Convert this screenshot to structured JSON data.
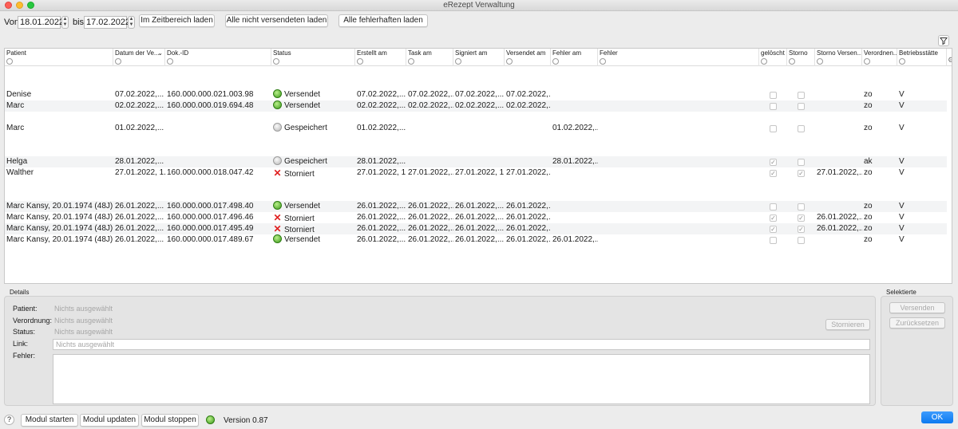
{
  "window": {
    "title": "eRezept Verwaltung"
  },
  "toolbar": {
    "from_label": "Von",
    "from_date": "18.01.2022",
    "to_label": "bis",
    "to_date": "17.02.2022",
    "btn_range": "Im Zeitbereich laden",
    "btn_unsent": "Alle nicht versendeten laden",
    "btn_errors": "Alle fehlerhaften laden"
  },
  "table": {
    "columns": [
      "Patient",
      "Datum der Ve...",
      "Dok.-ID",
      "Status",
      "Erstellt am",
      "Task am",
      "Signiert am",
      "Versendet am",
      "Fehler am",
      "Fehler",
      "gelöscht",
      "Storno",
      "Storno Versen...",
      "Verordnen...",
      "Betriebsstätte"
    ],
    "sort_indicator": "⌄",
    "rows": [
      {
        "patient": "Denise",
        "datum": "07.02.2022,...",
        "dok": "160.000.000.021.003.98",
        "status": "Versendet",
        "status_icon": "green",
        "erstellt": "07.02.2022,...",
        "task": "07.02.2022,...",
        "signiert": "07.02.2022,...",
        "versendet": "07.02.2022,...",
        "fehler_am": "",
        "fehler": "",
        "geloescht": false,
        "storno": false,
        "storno_versendet": "",
        "verordner": "zo",
        "betrieb": "V"
      },
      {
        "patient": "Marc",
        "datum": "02.02.2022,...",
        "dok": "160.000.000.019.694.48",
        "status": "Versendet",
        "status_icon": "green",
        "erstellt": "02.02.2022,...",
        "task": "02.02.2022,...",
        "signiert": "02.02.2022,...",
        "versendet": "02.02.2022,...",
        "fehler_am": "",
        "fehler": "",
        "geloescht": false,
        "storno": false,
        "storno_versendet": "",
        "verordner": "zo",
        "betrieb": "V"
      },
      {
        "patient": "Marc",
        "datum": "01.02.2022,...",
        "dok": "",
        "status": "Gespeichert",
        "status_icon": "gray",
        "erstellt": "01.02.2022,...",
        "task": "",
        "signiert": "",
        "versendet": "",
        "fehler_am": "01.02.2022,...",
        "fehler": "",
        "geloescht": false,
        "storno": false,
        "storno_versendet": "",
        "verordner": "zo",
        "betrieb": "V"
      },
      {
        "patient": "Helga",
        "datum": "28.01.2022,...",
        "dok": "",
        "status": "Gespeichert",
        "status_icon": "gray",
        "erstellt": "28.01.2022,...",
        "task": "",
        "signiert": "",
        "versendet": "",
        "fehler_am": "28.01.2022,...",
        "fehler": "",
        "geloescht": true,
        "storno": false,
        "storno_versendet": "",
        "verordner": "ak",
        "betrieb": "V"
      },
      {
        "patient": "Walther",
        "datum": "27.01.2022, 1...",
        "dok": "160.000.000.018.047.42",
        "status": "Storniert",
        "status_icon": "x",
        "erstellt": "27.01.2022, 1...",
        "task": "27.01.2022,...",
        "signiert": "27.01.2022, 1...",
        "versendet": "27.01.2022,...",
        "fehler_am": "",
        "fehler": "",
        "geloescht": true,
        "storno": true,
        "storno_versendet": "27.01.2022,...",
        "verordner": "zo",
        "betrieb": "V"
      },
      {
        "patient": "Marc Kansy, 20.01.1974 (48J)",
        "datum": "26.01.2022,...",
        "dok": "160.000.000.017.498.40",
        "status": "Versendet",
        "status_icon": "green",
        "erstellt": "26.01.2022,...",
        "task": "26.01.2022,...",
        "signiert": "26.01.2022,...",
        "versendet": "26.01.2022,...",
        "fehler_am": "",
        "fehler": "",
        "geloescht": false,
        "storno": false,
        "storno_versendet": "",
        "verordner": "zo",
        "betrieb": "V"
      },
      {
        "patient": "Marc Kansy, 20.01.1974 (48J)",
        "datum": "26.01.2022,...",
        "dok": "160.000.000.017.496.46",
        "status": "Storniert",
        "status_icon": "x",
        "erstellt": "26.01.2022,...",
        "task": "26.01.2022,...",
        "signiert": "26.01.2022,...",
        "versendet": "26.01.2022,...",
        "fehler_am": "",
        "fehler": "",
        "geloescht": true,
        "storno": true,
        "storno_versendet": "26.01.2022,...",
        "verordner": "zo",
        "betrieb": "V"
      },
      {
        "patient": "Marc Kansy, 20.01.1974 (48J)",
        "datum": "26.01.2022,...",
        "dok": "160.000.000.017.495.49",
        "status": "Storniert",
        "status_icon": "x",
        "erstellt": "26.01.2022,...",
        "task": "26.01.2022,...",
        "signiert": "26.01.2022,...",
        "versendet": "26.01.2022,...",
        "fehler_am": "",
        "fehler": "",
        "geloescht": true,
        "storno": true,
        "storno_versendet": "26.01.2022,...",
        "verordner": "zo",
        "betrieb": "V"
      },
      {
        "patient": "Marc Kansy, 20.01.1974 (48J)",
        "datum": "26.01.2022,...",
        "dok": "160.000.000.017.489.67",
        "status": "Versendet",
        "status_icon": "green",
        "erstellt": "26.01.2022,...",
        "task": "26.01.2022,...",
        "signiert": "26.01.2022,...",
        "versendet": "26.01.2022,...",
        "fehler_am": "26.01.2022,...",
        "fehler": "",
        "geloescht": false,
        "storno": false,
        "storno_versendet": "",
        "verordner": "zo",
        "betrieb": "V"
      }
    ]
  },
  "details": {
    "title": "Details",
    "patient_label": "Patient:",
    "patient_value": "Nichts ausgewählt",
    "verordnung_label": "Verordnung:",
    "verordnung_value": "Nichts ausgewählt",
    "status_label": "Status:",
    "status_value": "Nichts ausgewählt",
    "link_label": "Link:",
    "link_placeholder": "Nichts ausgewählt",
    "fehler_label": "Fehler:",
    "stornieren": "Stornieren"
  },
  "selected": {
    "title": "Selektierte",
    "send": "Versenden",
    "reset": "Zurücksetzen"
  },
  "footer": {
    "help": "?",
    "start": "Modul starten",
    "update": "Modul updaten",
    "stop": "Modul stoppen",
    "version": "Version 0.87",
    "ok": "OK"
  },
  "colors": {
    "accent": "#0c7af0",
    "status_green": "#3d9a1b",
    "status_x": "#e02020"
  }
}
